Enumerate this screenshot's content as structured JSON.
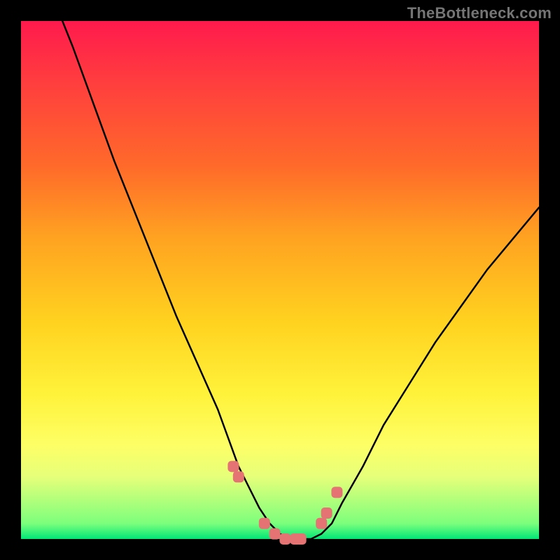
{
  "watermark": "TheBottleneck.com",
  "chart_data": {
    "type": "line",
    "title": "",
    "xlabel": "",
    "ylabel": "",
    "xlim": [
      0,
      100
    ],
    "ylim": [
      0,
      100
    ],
    "grid": false,
    "legend": false,
    "background_gradient": {
      "top": "#ff1a4d",
      "bottom": "#00e676"
    },
    "series": [
      {
        "name": "bottleneck-curve",
        "type": "line",
        "color": "#000000",
        "x": [
          8,
          10,
          14,
          18,
          22,
          26,
          30,
          34,
          38,
          42,
          44,
          46,
          48,
          50,
          52,
          54,
          56,
          58,
          60,
          62,
          66,
          70,
          75,
          80,
          85,
          90,
          95,
          100
        ],
        "values": [
          100,
          95,
          84,
          73,
          63,
          53,
          43,
          34,
          25,
          14,
          10,
          6,
          3,
          1,
          0,
          0,
          0,
          1,
          3,
          7,
          14,
          22,
          30,
          38,
          45,
          52,
          58,
          64
        ]
      },
      {
        "name": "optimal-markers",
        "type": "scatter",
        "color": "#e57373",
        "marker": "rounded-square",
        "x": [
          41,
          42,
          47,
          49,
          51,
          53,
          54,
          58,
          59,
          61
        ],
        "values": [
          14,
          12,
          3,
          1,
          0,
          0,
          0,
          3,
          5,
          9
        ]
      }
    ]
  }
}
